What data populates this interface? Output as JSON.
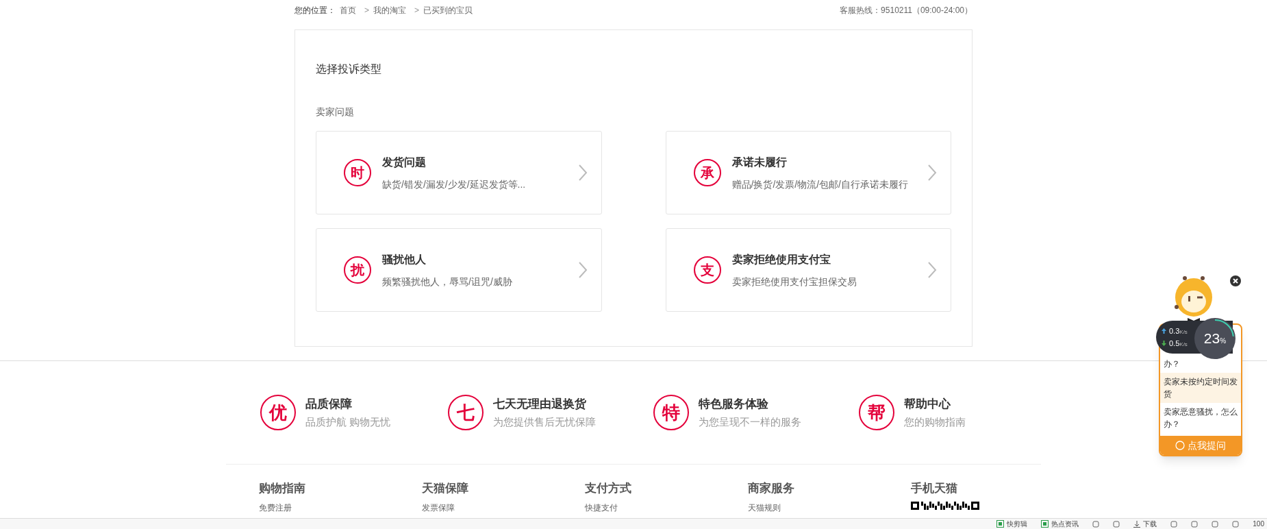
{
  "breadcrumb": {
    "label": "您的位置：",
    "items": [
      "首页",
      "我的淘宝",
      "已买到的宝贝"
    ],
    "separator": ">"
  },
  "hotline": "客服热线：9510211（09:00-24:00）",
  "complaint": {
    "title": "选择投诉类型",
    "section": "卖家问题",
    "options": [
      {
        "badge": "时",
        "title": "发货问题",
        "desc": "缺货/错发/漏发/少发/延迟发货等..."
      },
      {
        "badge": "承",
        "title": "承诺未履行",
        "desc": "赠品/换货/发票/物流/包邮/自行承诺未履行"
      },
      {
        "badge": "扰",
        "title": "骚扰他人",
        "desc": "频繁骚扰他人，辱骂/诅咒/威胁"
      },
      {
        "badge": "支",
        "title": "卖家拒绝使用支付宝",
        "desc": "卖家拒绝使用支付宝担保交易"
      }
    ]
  },
  "services": [
    {
      "badge": "优",
      "title": "品质保障",
      "desc": "品质护航 购物无忧"
    },
    {
      "badge": "七",
      "title": "七天无理由退换货",
      "desc": "为您提供售后无忧保障"
    },
    {
      "badge": "特",
      "title": "特色服务体验",
      "desc": "为您呈现不一样的服务"
    },
    {
      "badge": "帮",
      "title": "帮助中心",
      "desc": "您的购物指南"
    }
  ],
  "footer_columns": [
    {
      "title": "购物指南",
      "link": "免费注册"
    },
    {
      "title": "天猫保障",
      "link": "发票保障"
    },
    {
      "title": "支付方式",
      "link": "快捷支付"
    },
    {
      "title": "商家服务",
      "link": "天猫规则"
    },
    {
      "title": "手机天猫",
      "kind": "qr"
    }
  ],
  "assistant": {
    "questions": [
      {
        "text": "办？",
        "highlighted": false
      },
      {
        "text": "卖家未按约定时间发货",
        "highlighted": true
      },
      {
        "text": "卖家恶意骚扰，怎么办？",
        "highlighted": false
      }
    ],
    "ask_button": "点我提问"
  },
  "speed_monitor": {
    "upload": "0.3",
    "upload_unit": "K/s",
    "download": "0.5",
    "download_unit": "K/s",
    "percent": "23",
    "percent_sign": "%",
    "level": 0.23
  },
  "status_bar": {
    "items": [
      {
        "kind": "app",
        "text": "快剪辑"
      },
      {
        "kind": "app",
        "text": "热点资讯"
      },
      {
        "kind": "icon"
      },
      {
        "kind": "icon"
      },
      {
        "kind": "download",
        "text": "下载"
      },
      {
        "kind": "icon"
      },
      {
        "kind": "icon"
      },
      {
        "kind": "icon"
      },
      {
        "kind": "icon"
      },
      {
        "kind": "zoom",
        "text": "100"
      }
    ]
  }
}
